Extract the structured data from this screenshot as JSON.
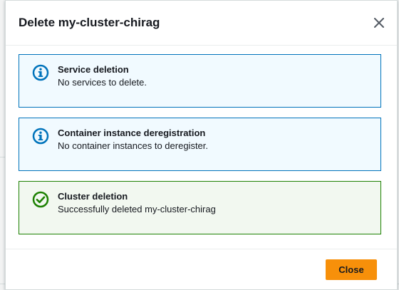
{
  "modal": {
    "title": "Delete my-cluster-chirag",
    "close_icon": "close-icon"
  },
  "alerts": [
    {
      "type": "info",
      "icon": "info-icon",
      "title": "Service deletion",
      "text": "No services to delete."
    },
    {
      "type": "info",
      "icon": "info-icon",
      "title": "Container instance deregistration",
      "text": "No container instances to deregister."
    },
    {
      "type": "success",
      "icon": "check-circle-icon",
      "title": "Cluster deletion",
      "text": "Successfully deleted my-cluster-chirag"
    }
  ],
  "footer": {
    "close_label": "Close"
  },
  "colors": {
    "info_border": "#0073bb",
    "info_bg": "#f1faff",
    "success_border": "#1d8102",
    "success_bg": "#f2f8f0",
    "primary_button": "#f7900a"
  }
}
